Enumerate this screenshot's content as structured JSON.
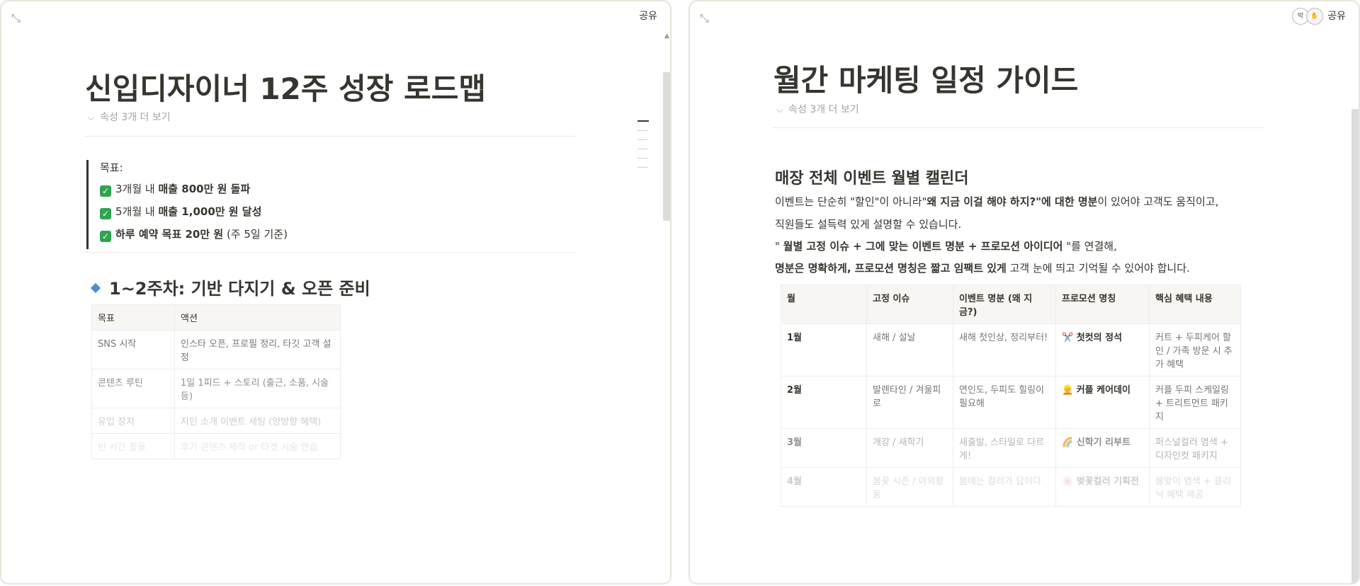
{
  "left": {
    "share": "공유",
    "title": "신입디자이너 12주 성장 로드맵",
    "props": "속성 3개 더 보기",
    "goal_title": "목표:",
    "goals": [
      {
        "pre": "3개월 내 ",
        "bold": "매출 800만 원 돌파",
        "post": ""
      },
      {
        "pre": "5개월 내 ",
        "bold": "매출 1,000만 원 달성",
        "post": ""
      },
      {
        "pre": "",
        "bold": "하루 예약 목표 20만 원",
        "post": " (주 5일 기준)"
      }
    ],
    "section": "1~2주차: 기반 다지기 & 오픈 준비",
    "table": {
      "headers": [
        "목표",
        "액션"
      ],
      "rows": [
        [
          "SNS 시작",
          "인스타 오픈, 프로필 정리, 타깃 고객 설정"
        ],
        [
          "콘텐츠 루틴",
          "1일 1피드 + 스토리 (출근, 소품, 시술 등)"
        ],
        [
          "유입 장치",
          "지인 소개 이벤트 세팅 (양방향 혜택)"
        ],
        [
          "빈 시간 활용",
          "후기 콘텐츠 제작 or 타겟 시술 연습"
        ]
      ]
    }
  },
  "right": {
    "share": "공유",
    "avatar": "박",
    "title": "월간 마케팅 일정 가이드",
    "props": "속성 3개 더 보기",
    "heading": "매장 전체 이벤트 월별 캘린더",
    "p1a": "이벤트는 단순히 \"할인\"이 아니라\"",
    "p1b": "왜 지금 이걸 해야 하지?\"에 대한 명분",
    "p1c": "이 있어야 고객도 움직이고,",
    "p2": "직원들도 설득력 있게 설명할 수 있습니다.",
    "p3a": "\" ",
    "p3b": "월별 고정 이슈 + 그에 맞는 이벤트 명분 + 프로모션 아이디어",
    "p3c": " \"를 연결해,",
    "p4b": "명분은 명확하게, 프로모션 명칭은 짧고 임팩트 있게",
    "p4c": " 고객 눈에 띄고 기억될 수 있어야 합니다.",
    "table": {
      "headers": [
        "월",
        "고정 이슈",
        "이벤트 명분 (왜 지금?)",
        "프로모션 명칭",
        "핵심 혜택 내용"
      ],
      "rows": [
        {
          "month": "1월",
          "issue": "새해 / 설날",
          "reason": "새해 첫인상, 정리부터!",
          "emoji": "✂️",
          "promo": "첫컷의 정석",
          "benefit": "커트 + 두피케어 할인 / 가족 방문 시 추가 혜택"
        },
        {
          "month": "2월",
          "issue": "발렌타인 / 겨울피로",
          "reason": "연인도, 두피도 힐링이 필요해",
          "emoji": "👱",
          "promo": "커플 케어데이",
          "benefit": "커플 두피 스케일링 + 트리트먼트 패키지"
        },
        {
          "month": "3월",
          "issue": "개강 / 새학기",
          "reason": "새출발, 스타일로 다르게!",
          "emoji": "🌈",
          "promo": "신학기 리부트",
          "benefit": "퍼스널컬러 염색 + 디자인컷 패키지"
        },
        {
          "month": "4월",
          "issue": "봄꽃 시즌 / 야외활동",
          "reason": "봄에는 컬러가 답이다",
          "emoji": "🌸",
          "promo": "벚꽃컬러 기획전",
          "benefit": "봄맞이 염색 + 클리닉 혜택 제공"
        }
      ]
    }
  }
}
